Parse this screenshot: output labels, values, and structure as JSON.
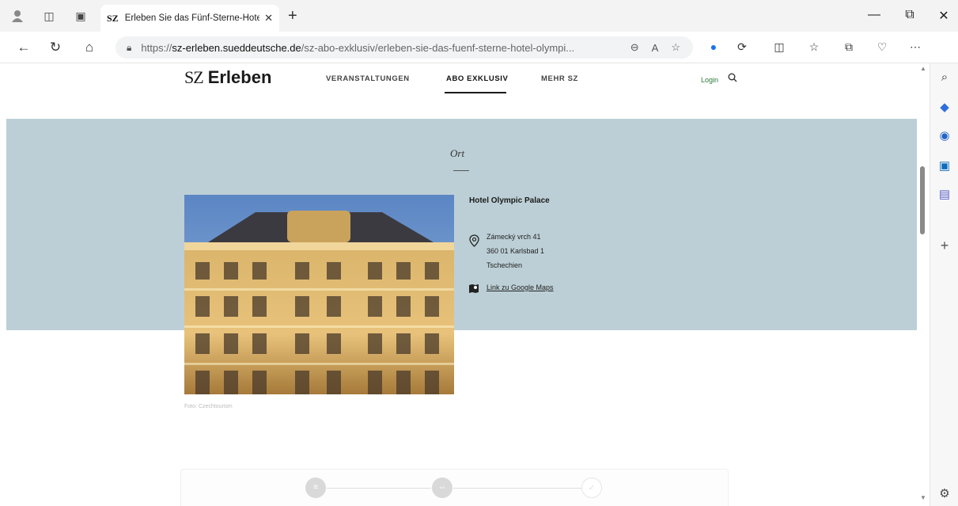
{
  "browser": {
    "tab_title": "Erleben Sie das Fünf-Sterne-Hote",
    "tab_favicon": "SZ",
    "tab_close": "✕",
    "new_tab": "+",
    "url_scheme": "https://",
    "url_host": "sz-erleben.sueddeutsche.de",
    "url_path": "/sz-abo-exklusiv/erleben-sie-das-fuenf-sterne-hotel-olympi...",
    "window_controls": [
      "—",
      "⧉",
      "✕"
    ]
  },
  "site": {
    "logo_mark": "SZ",
    "logo_text": "Erleben",
    "menu": [
      "VERANSTALTUNGEN",
      "ABO EXKLUSIV",
      "MEHR SZ"
    ],
    "active_menu": "ABO EXKLUSIV",
    "login": "Login"
  },
  "location": {
    "section_title": "Ort",
    "hotel_name": "Hotel Olympic Palace",
    "address_line1": "Zámecký vrch 41",
    "address_line2": "360 01 Karlsbad 1",
    "address_line3": "Tschechien",
    "maps_link": "Link zu Google Maps",
    "photo_credit": "Foto: Czechtourism"
  },
  "colors": {
    "band": "#bccfd6",
    "login": "#2a7a3b"
  },
  "icons": {
    "pin": "location-pin-icon",
    "maps": "map-icon",
    "search": "search-icon"
  }
}
